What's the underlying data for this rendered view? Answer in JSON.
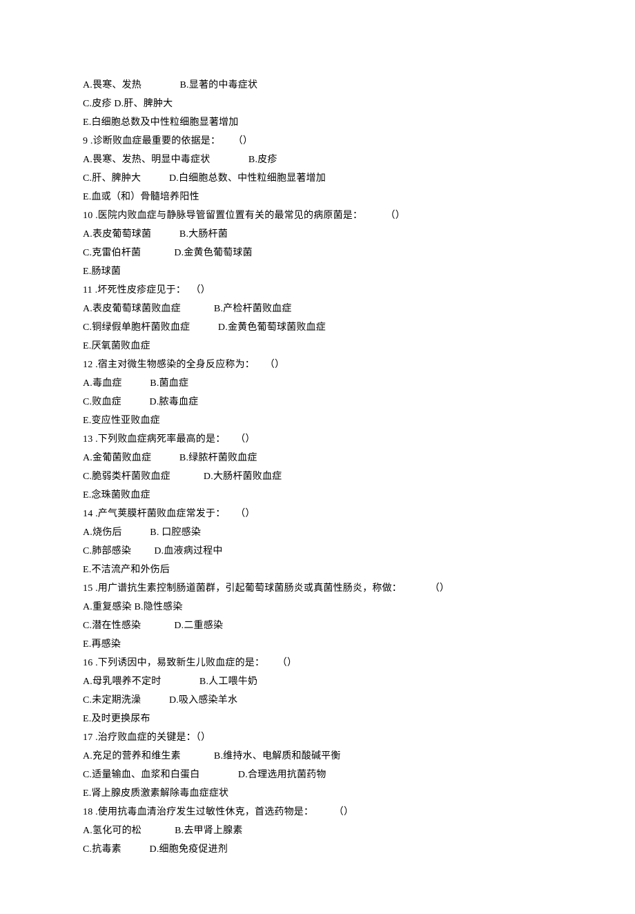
{
  "lines": [
    "A.畏寒、发热               B.显著的中毒症状",
    "C.皮疹 D.肝、脾肿大",
    "E.白细胞总数及中性粒细胞显著增加",
    "9 .诊断败血症最重要的依据是：     （）",
    "A.畏寒、发热、明显中毒症状               B.皮疹",
    "C.肝、脾肿大           D.白细胞总数、中性粒细胞显著增加",
    "E.血或（和）骨髓培养阳性",
    "10 .医院内败血症与静脉导管留置位置有关的最常见的病原菌是：         （）",
    "A.表皮葡萄球菌           B.大肠杆菌",
    "C.克雷伯杆菌             D.金黄色葡萄球菌",
    "E.肠球菌",
    "11 .坏死性皮疹症见于：  （）",
    "A.表皮葡萄球菌败血症             B.产检杆菌败血症",
    "C.铜绿假单胞杆菌败血症           D.金黄色葡萄球菌败血症",
    "E.厌氧菌败血症",
    "12 .宿主对微生物感染的全身反应称为：    （）",
    "A.毒血症           B.菌血症",
    "C.败血症           D.脓毒血症",
    "E.变应性亚败血症",
    "13 .下列败血症病死率最高的是：    （）",
    "A.金葡菌败血症           B.绿脓杆菌败血症",
    "C.脆弱类杆菌败血症             D.大肠杆菌败血症",
    "E.念珠菌败血症",
    "14 .产气荚膜杆菌败血症常发于：    （）",
    "A.烧伤后           B. 口腔感染",
    "C.肺部感染         D.血液病过程中",
    "E.不洁流产和外伤后",
    "15 .用广谱抗生素控制肠道菌群，引起葡萄球菌肠炎或真菌性肠炎，称做：           （）",
    "A.重复感染 B.隐性感染",
    "C.潜在性感染             D.二重感染",
    "E.再感染",
    "16 .下列诱因中，易致新生儿败血症的是：     （）",
    "A.母乳喂养不定时               B.人工喂牛奶",
    "C.未定期洗澡           D.吸入感染羊水",
    "E.及时更换尿布",
    "17 .治疗败血症的关键是：（）",
    "A.充足的营养和维生素             B.维持水、电解质和酸碱平衡",
    "C.适量输血、血浆和白蛋白               D.合理选用抗菌药物",
    "E.肾上腺皮质激素解除毒血症症状",
    "18 .使用抗毒血清治疗发生过敏性休克，首选药物是：        （）",
    "A.氢化可的松             B.去甲肾上腺素",
    "C.抗毒素           D.细胞免疫促进剂"
  ]
}
